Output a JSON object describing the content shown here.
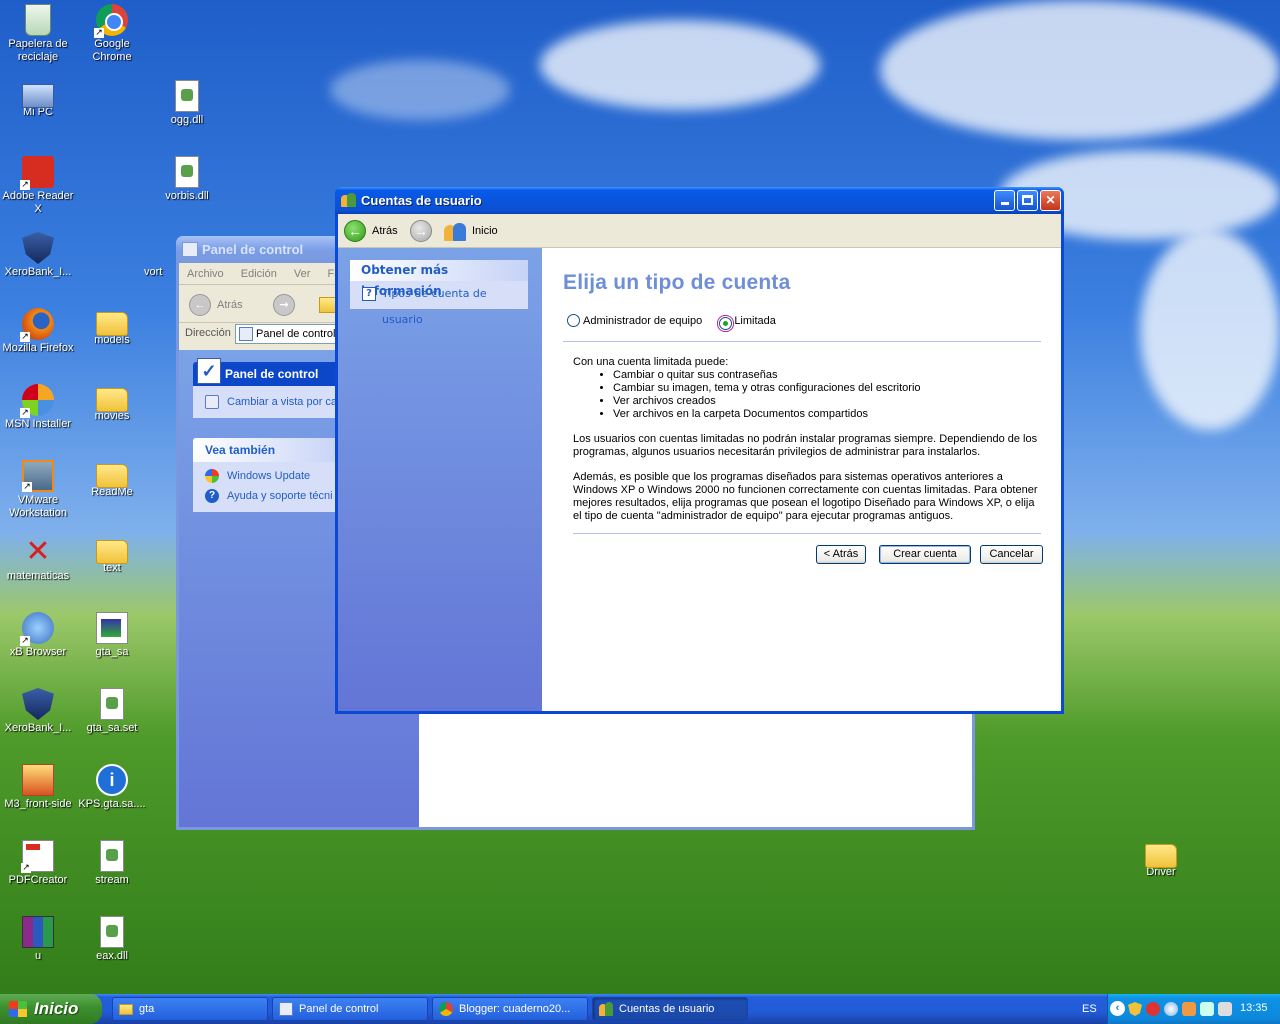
{
  "colors": {
    "titlebar_active": "#0a5ae8",
    "task_pane": "#6375d6",
    "link": "#215dc6",
    "heading": "#6e8fd8",
    "taskbar": "#245edb",
    "start": "#3c8f2d"
  },
  "desktop_icons": [
    {
      "label": "Papelera de reciclaje",
      "icon": "recycle-bin-icon"
    },
    {
      "label": "Google Chrome",
      "icon": "chrome-icon"
    },
    {
      "label": "Mi PC",
      "icon": "my-computer-icon"
    },
    {
      "label": "ogg.dll",
      "icon": "dll-file-icon"
    },
    {
      "label": "Adobe Reader X",
      "icon": "adobe-reader-icon"
    },
    {
      "label": "vorbis.dll",
      "icon": "dll-file-icon"
    },
    {
      "label": "XeroBank_I...",
      "icon": "xerobank-shield-icon"
    },
    {
      "label": "Mozilla Firefox",
      "icon": "firefox-icon"
    },
    {
      "label": "models",
      "icon": "folder-icon"
    },
    {
      "label": "MSN Installer",
      "icon": "msn-icon"
    },
    {
      "label": "movies",
      "icon": "folder-icon"
    },
    {
      "label": "VMware Workstation",
      "icon": "vmware-icon"
    },
    {
      "label": "ReadMe",
      "icon": "folder-icon"
    },
    {
      "label": "matematicas",
      "icon": "red-x-icon"
    },
    {
      "label": "text",
      "icon": "folder-icon"
    },
    {
      "label": "xB Browser",
      "icon": "xb-browser-icon"
    },
    {
      "label": "gta_sa",
      "icon": "gta-sa-icon"
    },
    {
      "label": "XeroBank_I...",
      "icon": "xerobank-shield-icon"
    },
    {
      "label": "gta_sa.set",
      "icon": "set-file-icon"
    },
    {
      "label": "M3_front-side",
      "icon": "image-file-icon"
    },
    {
      "label": "KPS.gta.sa....",
      "icon": "info-icon"
    },
    {
      "label": "PDFCreator",
      "icon": "pdfcreator-icon"
    },
    {
      "label": "stream",
      "icon": "dll-file-icon"
    },
    {
      "label": "u",
      "icon": "winrar-icon"
    },
    {
      "label": "eax.dll",
      "icon": "dll-file-icon"
    },
    {
      "label": "Driver",
      "icon": "folder-icon"
    }
  ],
  "control_panel": {
    "title": "Panel de control",
    "menu": [
      "Archivo",
      "Edición",
      "Ver",
      "Fa"
    ],
    "back_label": "Atrás",
    "address_label": "Dirección",
    "address_value": "Panel de control",
    "panel_title": "Panel de control",
    "switch_view": "Cambiar a vista por ca",
    "see_also_title": "Vea también",
    "see_also_items": [
      "Windows Update",
      "Ayuda y soporte técni"
    ],
    "partial_label": "vort"
  },
  "user_accounts": {
    "title": "Cuentas de usuario",
    "nav": {
      "back": "Atrás",
      "home": "Inicio"
    },
    "learn_more_title": "Obtener más información",
    "learn_more_item": "Tipos de cuenta de usuario",
    "heading": "Elija un tipo de cuenta",
    "options": [
      {
        "label": "Administrador de equipo",
        "selected": false
      },
      {
        "label": "Limitada",
        "selected": true
      }
    ],
    "intro": "Con una cuenta limitada puede:",
    "capabilities": [
      "Cambiar o quitar sus contraseñas",
      "Cambiar su imagen, tema y otras configuraciones del escritorio",
      "Ver archivos creados",
      "Ver archivos en la carpeta Documentos compartidos"
    ],
    "para1": "Los usuarios con cuentas limitadas no podrán instalar programas siempre. Dependiendo de los programas, algunos usuarios necesitarán privilegios de administrar para instalarlos.",
    "para2": "Además, es posible que los programas diseñados para sistemas operativos anteriores a Windows XP o Windows 2000 no funcionen correctamente con cuentas limitadas. Para obtener mejores resultados, elija programas que posean el logotipo Diseñado para Windows XP, o elija el tipo de cuenta \"administrador de equipo\" para ejecutar programas antiguos.",
    "buttons": {
      "back": "< Atrás",
      "create": "Crear cuenta",
      "cancel": "Cancelar"
    }
  },
  "taskbar": {
    "start_label": "Inicio",
    "tasks": [
      {
        "label": "gta",
        "icon": "folder-icon"
      },
      {
        "label": "Panel de control",
        "icon": "control-panel-icon"
      },
      {
        "label": "Blogger: cuaderno20...",
        "icon": "chrome-icon"
      },
      {
        "label": "Cuentas de usuario",
        "icon": "user-accounts-icon"
      }
    ],
    "language": "ES",
    "clock": "13:35"
  }
}
